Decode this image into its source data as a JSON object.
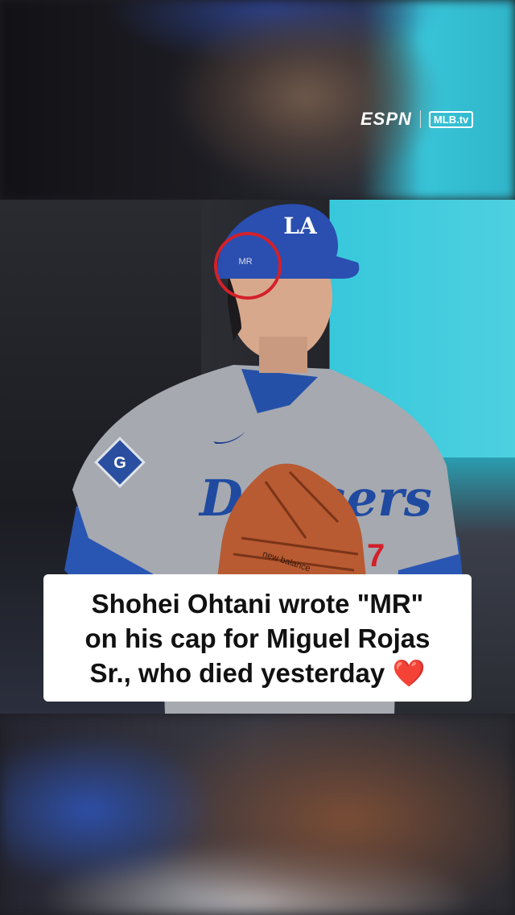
{
  "broadcast": {
    "network_logo": "ESPN",
    "partner_logo": "MLB.tv"
  },
  "photo": {
    "cap_logo": "LA",
    "cap_marking": "MR",
    "jersey_text": "Dodgers",
    "jersey_number_partial": "7",
    "patch_letter": "G",
    "glove_text": "new balance",
    "highlight_circle_color": "#d3202a"
  },
  "caption": {
    "line1": "Shohei Ohtani wrote \"MR\"",
    "line2": "on his cap for Miguel Rojas",
    "line3": "Sr., who died yesterday",
    "emoji": "❤️"
  }
}
